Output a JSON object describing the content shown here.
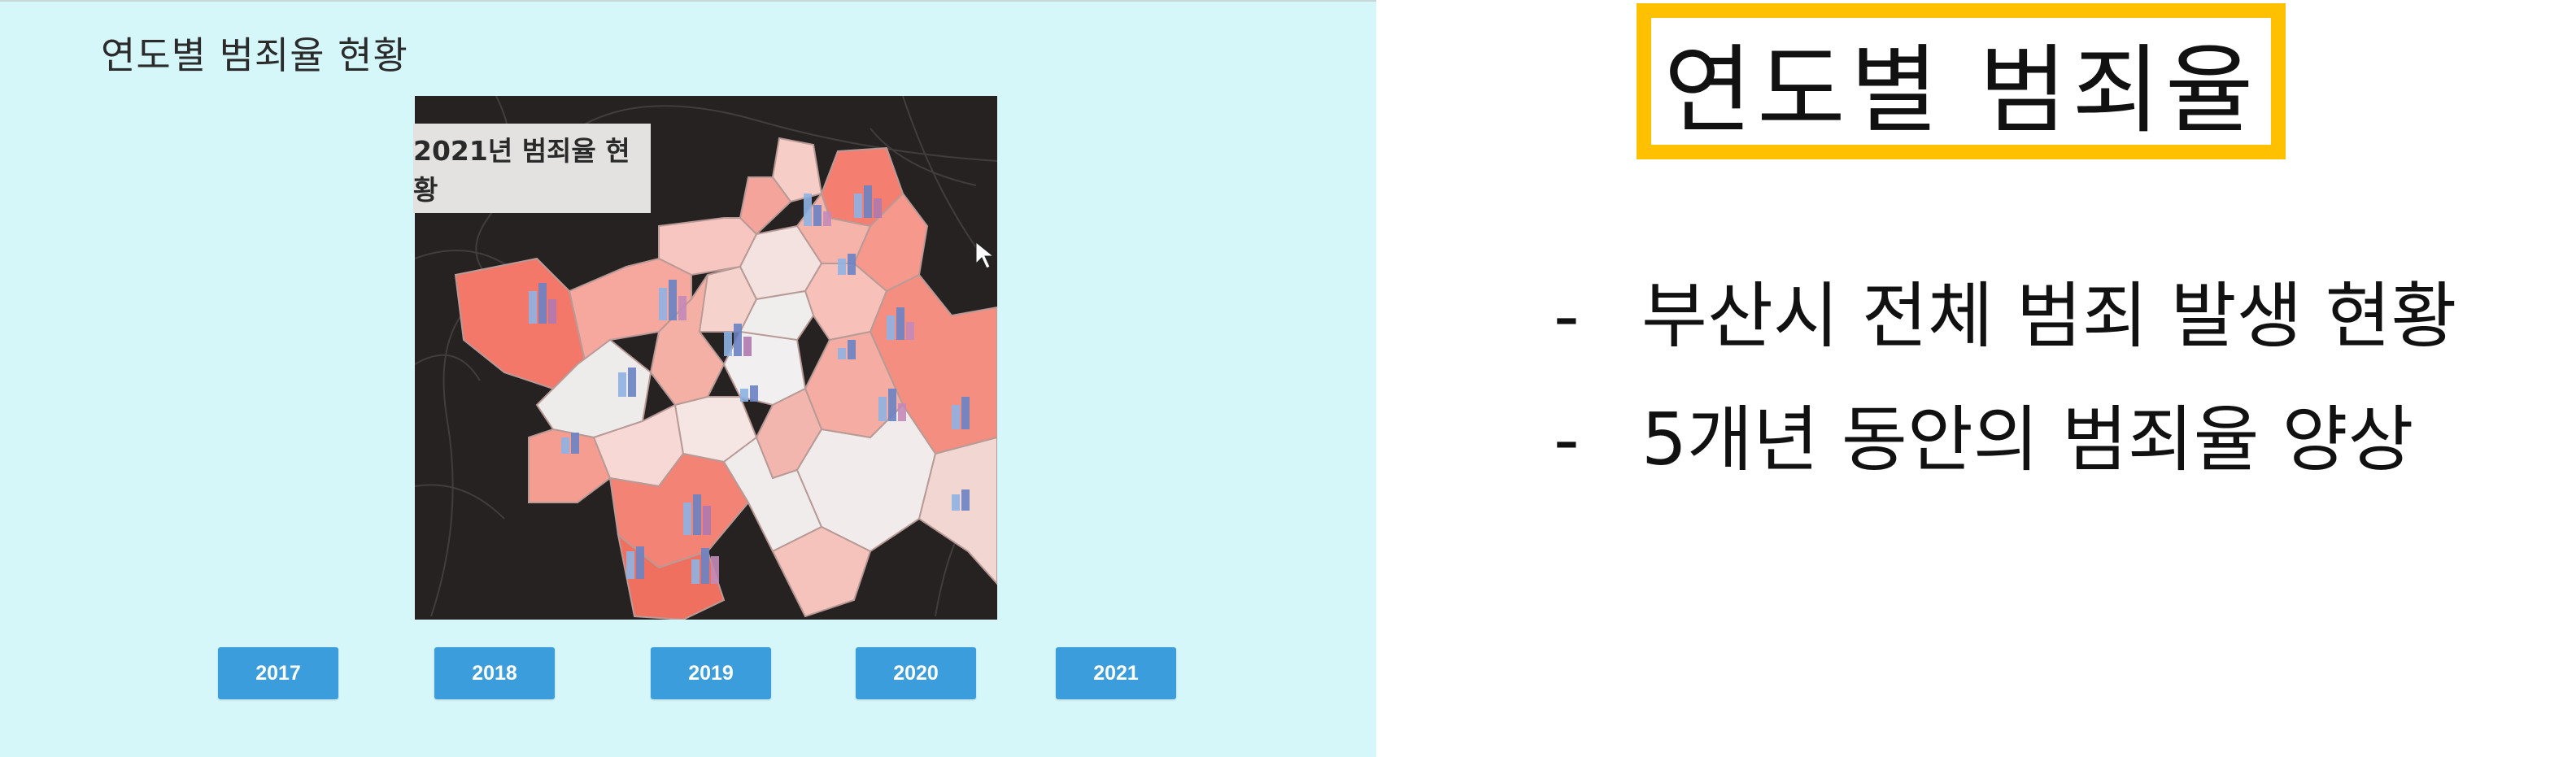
{
  "left_panel": {
    "heading": "연도별 범죄율 현황",
    "map_caption": "2021년 범죄율 현황",
    "year_buttons": [
      "2017",
      "2018",
      "2019",
      "2020",
      "2021"
    ],
    "map_icon": "district-choropleth-map"
  },
  "slide": {
    "title": "연도별 범죄율",
    "bullets": [
      {
        "marker": "-",
        "text": "부산시 전체 범죄 발생 현황"
      },
      {
        "marker": "-",
        "text": "5개년 동안의 범죄율 양상"
      }
    ]
  },
  "colors": {
    "panel_bg": "#d5f7f9",
    "button_bg": "#3b9ddb",
    "title_border": "#ffc000",
    "map_bg": "#262222",
    "district_high": "#f5877a",
    "district_mid": "#f7b8b0",
    "district_low": "#f1eeee"
  }
}
